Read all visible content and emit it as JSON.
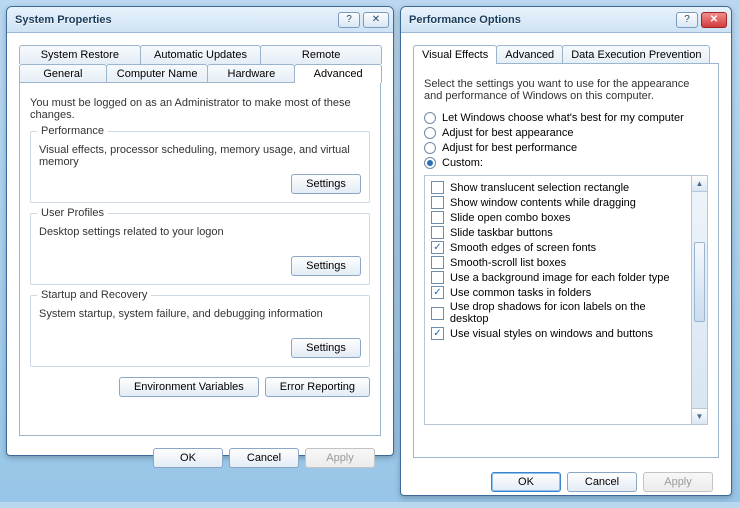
{
  "left": {
    "title": "System Properties",
    "tabs_row1": [
      "System Restore",
      "Automatic Updates",
      "Remote"
    ],
    "tabs_row2": [
      "General",
      "Computer Name",
      "Hardware",
      "Advanced"
    ],
    "active_tab": "Advanced",
    "admin_note": "You must be logged on as an Administrator to make most of these changes.",
    "groups": {
      "performance": {
        "title": "Performance",
        "desc": "Visual effects, processor scheduling, memory usage, and virtual memory",
        "button": "Settings"
      },
      "user_profiles": {
        "title": "User Profiles",
        "desc": "Desktop settings related to your logon",
        "button": "Settings"
      },
      "startup": {
        "title": "Startup and Recovery",
        "desc": "System startup, system failure, and debugging information",
        "button": "Settings"
      }
    },
    "env_vars": "Environment Variables",
    "error_reporting": "Error Reporting",
    "footer": {
      "ok": "OK",
      "cancel": "Cancel",
      "apply": "Apply"
    }
  },
  "right": {
    "title": "Performance Options",
    "tabs": [
      "Visual Effects",
      "Advanced",
      "Data Execution Prevention"
    ],
    "active_tab": "Visual Effects",
    "intro": "Select the settings you want to use for the appearance and performance of Windows on this computer.",
    "radios": [
      {
        "label": "Let Windows choose what's best for my computer",
        "checked": false
      },
      {
        "label": "Adjust for best appearance",
        "checked": false
      },
      {
        "label": "Adjust for best performance",
        "checked": false
      },
      {
        "label": "Custom:",
        "checked": true
      }
    ],
    "checks": [
      {
        "label": "Show translucent selection rectangle",
        "checked": false
      },
      {
        "label": "Show window contents while dragging",
        "checked": false
      },
      {
        "label": "Slide open combo boxes",
        "checked": false
      },
      {
        "label": "Slide taskbar buttons",
        "checked": false
      },
      {
        "label": "Smooth edges of screen fonts",
        "checked": true
      },
      {
        "label": "Smooth-scroll list boxes",
        "checked": false
      },
      {
        "label": "Use a background image for each folder type",
        "checked": false
      },
      {
        "label": "Use common tasks in folders",
        "checked": true
      },
      {
        "label": "Use drop shadows for icon labels on the desktop",
        "checked": false
      },
      {
        "label": "Use visual styles on windows and buttons",
        "checked": true
      }
    ],
    "footer": {
      "ok": "OK",
      "cancel": "Cancel",
      "apply": "Apply"
    }
  }
}
